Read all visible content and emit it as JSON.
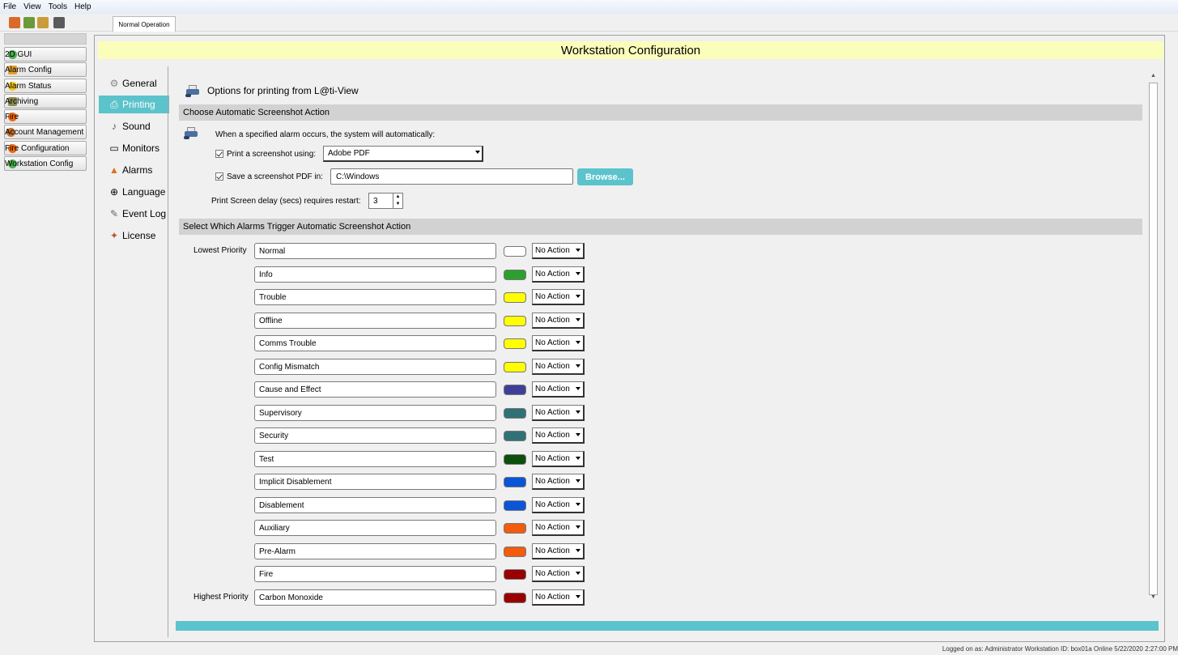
{
  "menu": [
    "File",
    "View",
    "Tools",
    "Help"
  ],
  "toolbar": {
    "icons": [
      "user-icon",
      "monitor-icon",
      "home-icon",
      "building-icon"
    ],
    "tab_label": "Normal Operation"
  },
  "sidebar": {
    "items": [
      {
        "label": "2D GUI",
        "icon": "globe-icon",
        "color": "#4caf50"
      },
      {
        "label": "Alarm Config",
        "icon": "wrench-icon",
        "color": "#e0a030"
      },
      {
        "label": "Alarm Status",
        "icon": "star-icon",
        "color": "#f3c71d"
      },
      {
        "label": "Archiving",
        "icon": "archive-icon",
        "color": "#8a8a50"
      },
      {
        "label": "Fire",
        "icon": "fire-icon",
        "color": "#f06a10"
      },
      {
        "label": "Account Management",
        "icon": "users-icon",
        "color": "#c07030"
      },
      {
        "label": "Fire Configuration",
        "icon": "fire-icon",
        "color": "#f06a10"
      },
      {
        "label": "Workstation Config",
        "icon": "globe-icon",
        "color": "#4caf50"
      }
    ]
  },
  "header": {
    "title": "Workstation Configuration"
  },
  "nav": {
    "items": [
      {
        "label": "General",
        "icon": "gear-icon",
        "glyph": "⚙"
      },
      {
        "label": "Printing",
        "icon": "printer-icon",
        "glyph": "⎙"
      },
      {
        "label": "Sound",
        "icon": "sound-icon",
        "glyph": "♪"
      },
      {
        "label": "Monitors",
        "icon": "monitor-icon",
        "glyph": "▭"
      },
      {
        "label": "Alarms",
        "icon": "alarm-icon",
        "glyph": "▲"
      },
      {
        "label": "Language",
        "icon": "globe-icon",
        "glyph": "⊕"
      },
      {
        "label": "Event Log",
        "icon": "log-icon",
        "glyph": "✎"
      },
      {
        "label": "License",
        "icon": "license-icon",
        "glyph": "✦"
      }
    ],
    "active": "Printing"
  },
  "printing": {
    "title": "Options for printing from L@ti-View",
    "section1": "Choose Automatic Screenshot Action",
    "intro": "When a specified alarm occurs, the system will automatically:",
    "print_label": "Print a screenshot using:",
    "printer_value": "Adobe PDF",
    "save_label": "Save a screenshot PDF in:",
    "save_path": "C:\\Windows",
    "browse_label": "Browse...",
    "delay_label": "Print Screen delay (secs) requires restart:",
    "delay_value": "3",
    "section2": "Select Which Alarms Trigger Automatic Screenshot Action",
    "lowest_label": "Lowest Priority",
    "highest_label": "Highest Priority"
  },
  "alarms": [
    {
      "name": "Normal",
      "color": "#ffffff",
      "action": "No Action"
    },
    {
      "name": "Info",
      "color": "#2ca02c",
      "action": "No Action"
    },
    {
      "name": "Trouble",
      "color": "#ffff00",
      "action": "No Action"
    },
    {
      "name": "Offline",
      "color": "#ffff00",
      "action": "No Action"
    },
    {
      "name": "Comms Trouble",
      "color": "#ffff00",
      "action": "No Action"
    },
    {
      "name": "Config Mismatch",
      "color": "#ffff00",
      "action": "No Action"
    },
    {
      "name": "Cause and Effect",
      "color": "#3f3f9a",
      "action": "No Action"
    },
    {
      "name": "Supervisory",
      "color": "#2f7175",
      "action": "No Action"
    },
    {
      "name": "Security",
      "color": "#2f7175",
      "action": "No Action"
    },
    {
      "name": "Test",
      "color": "#0d4d0d",
      "action": "No Action"
    },
    {
      "name": "Implicit Disablement",
      "color": "#0a55d8",
      "action": "No Action"
    },
    {
      "name": "Disablement",
      "color": "#0a55d8",
      "action": "No Action"
    },
    {
      "name": "Auxiliary",
      "color": "#f35b0d",
      "action": "No Action"
    },
    {
      "name": "Pre-Alarm",
      "color": "#f35b0d",
      "action": "No Action"
    },
    {
      "name": "Fire",
      "color": "#990000",
      "action": "No Action"
    },
    {
      "name": "Carbon Monoxide",
      "color": "#990000",
      "action": "No Action"
    }
  ],
  "status": "Logged on as: Administrator  Workstation ID: box01a  Online  5/22/2020 2:27:00 PM"
}
